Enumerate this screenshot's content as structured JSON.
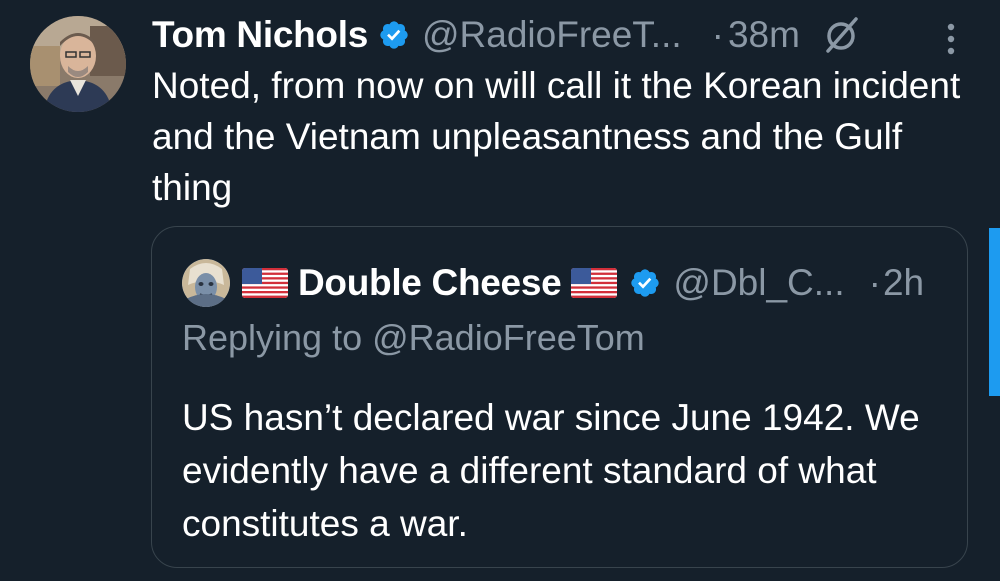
{
  "tweet": {
    "author_name": "Tom Nichols",
    "author_handle": "@RadioFreeT...",
    "separator": "·",
    "time": "38m",
    "text": "Noted, from now on will call it the Korean incident and the Vietnam unpleasantness and the Gulf thing"
  },
  "quoted_tweet": {
    "author_name": "Double Cheese",
    "author_handle": "@Dbl_C...",
    "separator": "·",
    "time": "2h",
    "replying_to": "Replying to @RadioFreeTom",
    "text": "US hasn’t declared war since June 1942. We evidently have a different standard of what constitutes a war."
  },
  "icons": {
    "verified": "verified-badge-icon",
    "grok": "grok-icon",
    "more": "more-options-icon",
    "flag": "us-flag-icon"
  },
  "colors": {
    "background": "#15202b",
    "text": "#ffffff",
    "secondary_text": "#8b98a5",
    "accent": "#1d9bf0",
    "border": "#38444d"
  }
}
